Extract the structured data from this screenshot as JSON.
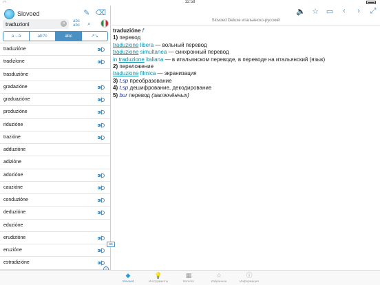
{
  "status": {
    "time": "12:58"
  },
  "app": {
    "name": "Slovoed"
  },
  "search": {
    "value": "traduzioni",
    "abc_label": "abc\nabc"
  },
  "modes": [
    "a→ā",
    "ab?c",
    "abc\nabd",
    "↗↘"
  ],
  "words": [
    "traduzióne",
    "tradizìone",
    "trasduzióne",
    "gradazióne",
    "graduazióne",
    "produzióne",
    "riduzióne",
    "trazióne",
    "adduzióne",
    "adizióne",
    "adozióne",
    "cauzióne",
    "conduzióne",
    "deduzióne",
    "eduzióne",
    "erudizióne",
    "eruzióne",
    "estradizióne"
  ],
  "speaker_rows": [
    0,
    1,
    3,
    4,
    5,
    6,
    7,
    10,
    11,
    12,
    13,
    15,
    16,
    17
  ],
  "dictionary_title": "Slovoed Deluxe итальянско-русский",
  "article": {
    "headword": "traduzióne",
    "gram": "f",
    "sense1_num": "1)",
    "sense1_trans": "перевод",
    "ex1_it": "libera",
    "ex1_ru": "— вольный перевод",
    "ex2_it": "simultanea",
    "ex2_ru": "— синхронный перевод",
    "ex3_pre": "in",
    "ex3_it": "italiana",
    "ex3_ru": "— в итальянском переводе, в переводе на итальянский (язык)",
    "sense2_num": "2)",
    "sense2_trans": "переложение",
    "ex4_it": "filmica",
    "ex4_ru": "— экранизация",
    "ref_word": "traduzione",
    "sense3_num": "3)",
    "sense3_lbl": "t.sp",
    "sense3_trans": "преобразование",
    "sense4_num": "4)",
    "sense4_lbl": "t.sp",
    "sense4_trans": "дешифрование, декодирование",
    "sense5_num": "5)",
    "sense5_lbl": "bur",
    "sense5_trans": "перевод",
    "sense5_note": "(заключённых)"
  },
  "tabs": [
    {
      "label": "Slovoed",
      "icon": "slovoed-icon"
    },
    {
      "label": "Инструменты",
      "icon": "lightbulb-icon"
    },
    {
      "label": "Каталог",
      "icon": "catalog-icon"
    },
    {
      "label": "Избранное",
      "icon": "star-icon"
    },
    {
      "label": "Информация",
      "icon": "info-icon"
    }
  ],
  "colors": {
    "accent": "#4a90c2",
    "active_tab": "#2a9ad6"
  }
}
